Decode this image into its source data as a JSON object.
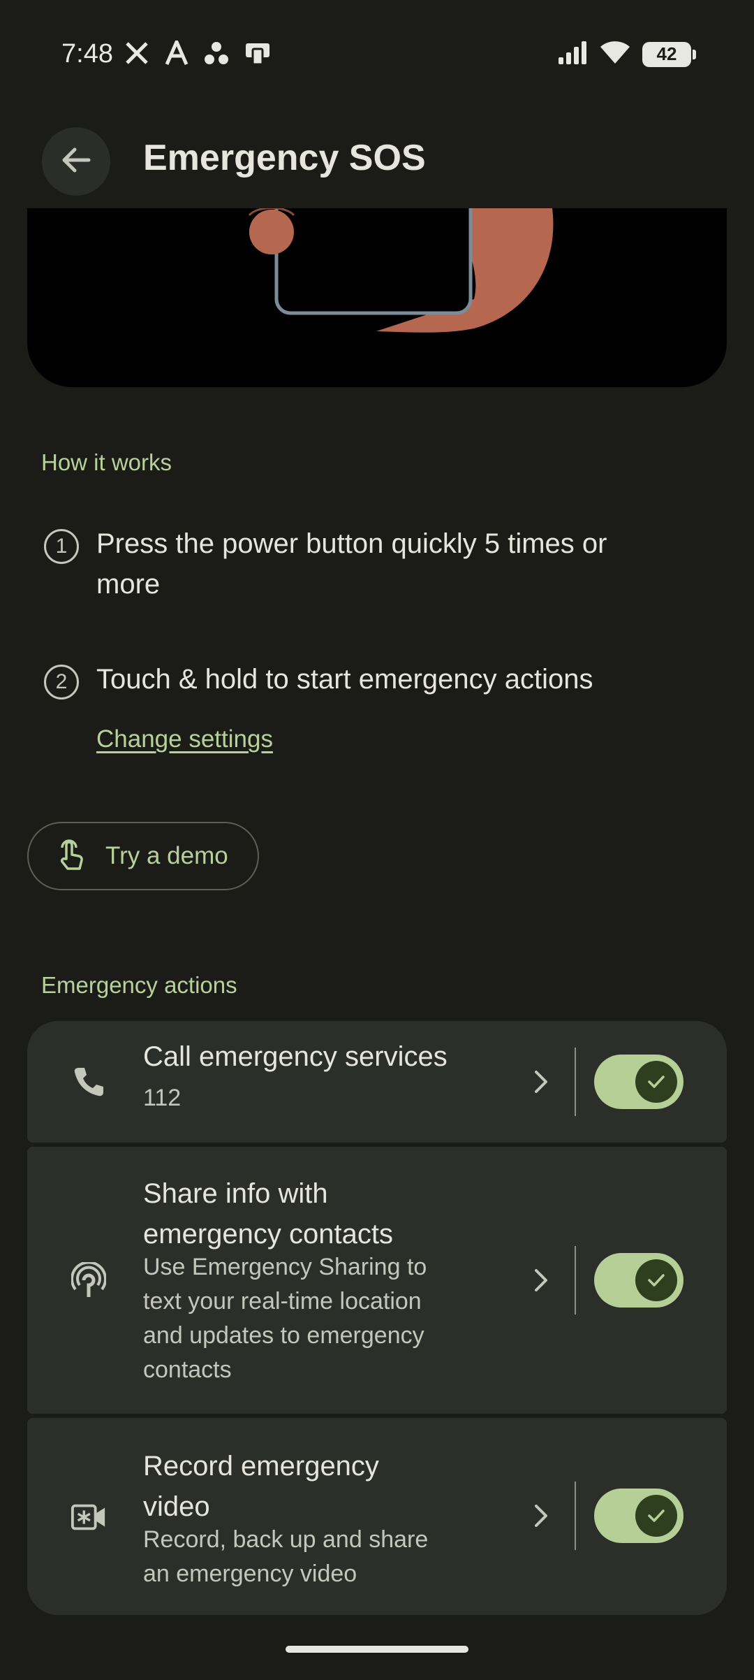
{
  "status_bar": {
    "time": "7:48",
    "notification_icons": [
      "x-icon",
      "font-a-icon",
      "dots-icon",
      "flashcard-icon"
    ],
    "battery": "42"
  },
  "app_bar": {
    "title": "Emergency SOS"
  },
  "how_it_works": {
    "label": "How it works",
    "steps": [
      {
        "num": "1",
        "text_line1": "Press the power button quickly 5 times or",
        "text_line2": "more"
      },
      {
        "num": "2",
        "text_line1": "Touch & hold to start emergency actions"
      }
    ],
    "change_settings": "Change settings"
  },
  "demo_button": {
    "label": "Try a demo"
  },
  "emergency_actions": {
    "label": "Emergency actions",
    "items": [
      {
        "title_line1": "Call emergency services",
        "subtitle": "112",
        "enabled": true,
        "icon": "phone-icon"
      },
      {
        "title_line1": "Share info with",
        "title_line2": "emergency contacts",
        "sub_line1": "Use Emergency Sharing to",
        "sub_line2": "text your real-time location",
        "sub_line3": "and updates to emergency",
        "sub_line4": "contacts",
        "enabled": true,
        "icon": "location-share-icon"
      },
      {
        "title_line1": "Record emergency",
        "title_line2": "video",
        "sub_line1": "Record, back up and share",
        "sub_line2": "an emergency video",
        "enabled": true,
        "icon": "video-icon"
      }
    ]
  },
  "colors": {
    "background": "#1b1c18",
    "accent": "#b8d19a",
    "card": "#2c2e29",
    "toggle_on": "#b5cf97"
  }
}
